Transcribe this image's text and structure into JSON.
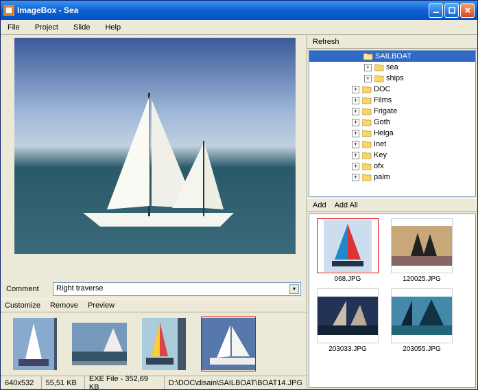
{
  "title": "ImageBox  - Sea",
  "menus": [
    "File",
    "Project",
    "Slide",
    "Help"
  ],
  "comment": {
    "label": "Comment",
    "value": "Right traverse"
  },
  "thumb_toolbar": [
    "Customize",
    "Remove",
    "Preview"
  ],
  "status": {
    "dimensions": "640x532",
    "size": "55,51 KB",
    "exe_info": "EXE File - 352,69 KB",
    "path": "D:\\DOC\\disain\\SAILBOAT\\BOAT14.JPG"
  },
  "refresh_label": "Refresh",
  "tree": [
    {
      "indent": 60,
      "toggle": "",
      "name": "SAILBOAT",
      "selected": true,
      "open": true
    },
    {
      "indent": 76,
      "toggle": "+",
      "name": "sea"
    },
    {
      "indent": 76,
      "toggle": "+",
      "name": "ships"
    },
    {
      "indent": 58,
      "toggle": "+",
      "name": "DOC"
    },
    {
      "indent": 58,
      "toggle": "+",
      "name": "Films"
    },
    {
      "indent": 58,
      "toggle": "+",
      "name": "Frigate"
    },
    {
      "indent": 58,
      "toggle": "+",
      "name": "Goth"
    },
    {
      "indent": 58,
      "toggle": "+",
      "name": "Helga"
    },
    {
      "indent": 58,
      "toggle": "+",
      "name": "Inet"
    },
    {
      "indent": 58,
      "toggle": "+",
      "name": "Key"
    },
    {
      "indent": 58,
      "toggle": "+",
      "name": "ofx"
    },
    {
      "indent": 58,
      "toggle": "+",
      "name": "palm"
    }
  ],
  "add_bar": [
    "Add",
    "Add All"
  ],
  "browse_items": [
    {
      "label": "068.JPG",
      "selected": true
    },
    {
      "label": "120025.JPG",
      "selected": false
    },
    {
      "label": "203033.JPG",
      "selected": false
    },
    {
      "label": "203055.JPG",
      "selected": false
    }
  ],
  "thumbs_selected_index": 3
}
